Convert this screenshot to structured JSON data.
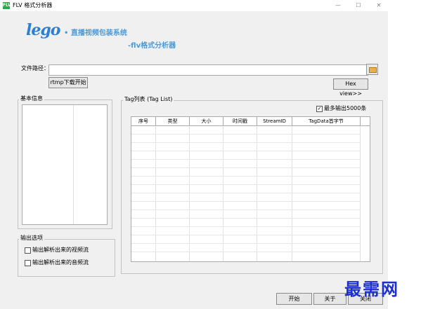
{
  "window": {
    "title": "FLV 格式分析器",
    "icon_label": "FLV",
    "controls": {
      "minimize": "—",
      "maximize": "☐",
      "close": "✕"
    }
  },
  "logo": {
    "brand": "lego",
    "tagline": "• 直播视频包装系统",
    "subtitle": "-flv格式分析器"
  },
  "file": {
    "label": "文件路径：",
    "value": "",
    "browse_icon": "folder-icon"
  },
  "buttons": {
    "rtmp_download": "rtmp下载开始",
    "hex_view": "Hex view>>",
    "start": "开始",
    "about": "关于",
    "close": "关闭"
  },
  "basic_info": {
    "title": "基本信息"
  },
  "output_options": {
    "title": "输出选项",
    "video_label": "输出解析出来的视频流",
    "video_checked": false,
    "audio_label": "输出解析出来的音频流",
    "audio_checked": false
  },
  "tag_list": {
    "title": "Tag列表 (Tag List)",
    "max_output_label": "最多输出5000条",
    "max_output_checked": true,
    "columns": [
      "序号",
      "类型",
      "大小",
      "时间戳",
      "StreamID",
      "TagData首字节"
    ]
  },
  "watermark": {
    "text": "最需网"
  }
}
